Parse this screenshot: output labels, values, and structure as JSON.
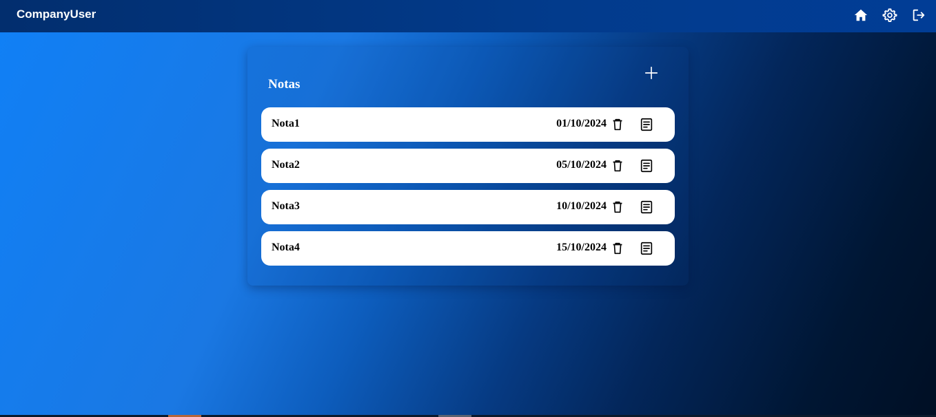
{
  "header": {
    "brand": "CompanyUser",
    "icons": [
      "home-icon",
      "settings-icon",
      "logout-icon"
    ]
  },
  "notes_panel": {
    "title": "Notas",
    "add_icon": "plus-icon",
    "notes": [
      {
        "name": "Nota1",
        "date": "01/10/2024"
      },
      {
        "name": "Nota2",
        "date": "05/10/2024"
      },
      {
        "name": "Nota3",
        "date": "10/10/2024"
      },
      {
        "name": "Nota4",
        "date": "15/10/2024"
      }
    ],
    "row_icons": [
      "trash-icon",
      "document-icon"
    ]
  },
  "colors": {
    "header_bg": "#023b8c",
    "gradient_start": "#1080f6",
    "gradient_end": "#000f24",
    "row_bg": "#ffffff",
    "text_light": "#ffffff",
    "text_dark": "#000000"
  }
}
